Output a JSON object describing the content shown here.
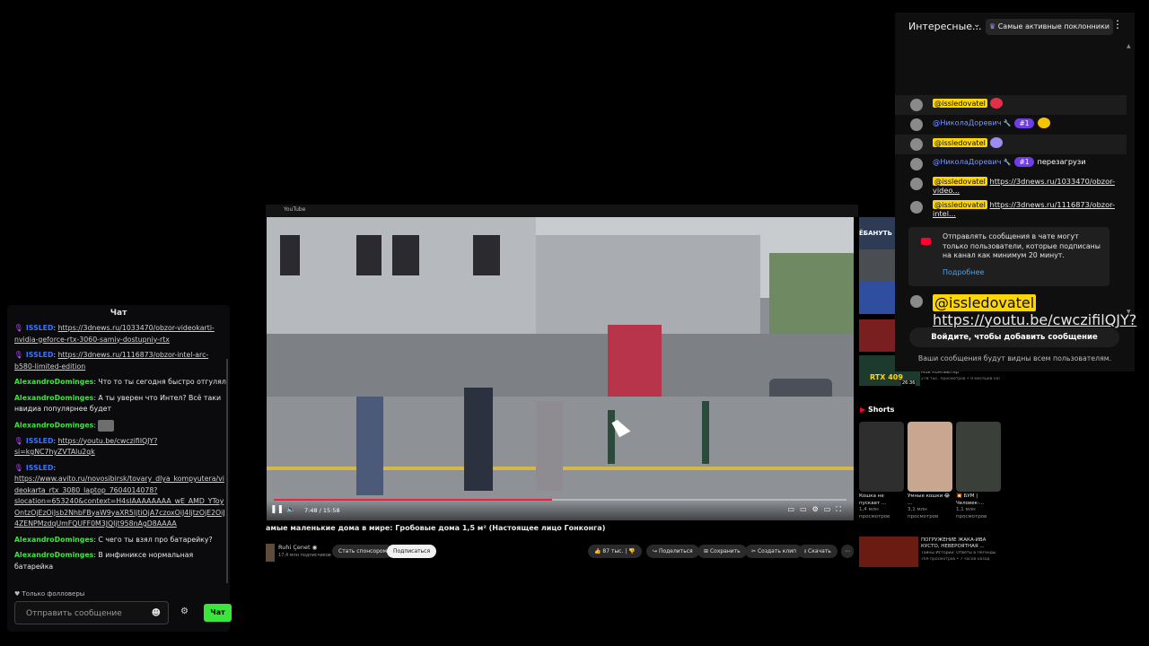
{
  "left_chat": {
    "title": "Чат",
    "messages": [
      {
        "icon": "🎙",
        "user": "ISSLED",
        "user_color": "#3a74ff",
        "text": "",
        "link": "https://3dnews.ru/1033470/obzor-videokarti-nvidia-geforce-rtx-3060-samiy-dostupniy-rtx"
      },
      {
        "icon": "🎙",
        "user": "ISSLED",
        "user_color": "#3a74ff",
        "text": "",
        "link": "https://3dnews.ru/1116873/obzor-intel-arc-b580-limited-edition"
      },
      {
        "icon": "",
        "user": "AlexandroDominges",
        "user_color": "#3be63b",
        "text": "Что то ты сегодня быстро отгулял",
        "link": ""
      },
      {
        "icon": "",
        "user": "AlexandroDominges",
        "user_color": "#3be63b",
        "text": "А ты уверен что Интел? Всё таки нвидиа популярнее будет",
        "link": ""
      },
      {
        "icon": "",
        "user": "AlexandroDominges",
        "user_color": "#3be63b",
        "text": "",
        "link": "",
        "emote": "cat-emote"
      },
      {
        "icon": "🎙",
        "user": "ISSLED",
        "user_color": "#3a74ff",
        "text": "",
        "link": "https://youtu.be/cwczifilQJY?si=kgNC7hyZVTAlu2qk"
      },
      {
        "icon": "🎙",
        "user": "ISSLED",
        "user_color": "#3a74ff",
        "text": "",
        "link": "https://www.avito.ru/novosibirsk/tovary_dlya_kompyutera/videokarta_rtx_3080_laptop_7604014078?slocation=653240&context=H4sIAAAAAAAA_wE_AMD_YToyOntzOjEzOiJsb2NhbFByaW9yaXR5IjtiOjA7czoxOiJ4IjtzOjE2OiJ4ZENPMzdqUmFQUFF0M3JQIjt958nAgD8AAAA"
      },
      {
        "icon": "",
        "user": "AlexandroDominges",
        "user_color": "#3be63b",
        "text": "С чего ты взял про батарейку?",
        "link": ""
      },
      {
        "icon": "",
        "user": "AlexandroDominges",
        "user_color": "#3be63b",
        "text": "В инфиниксе нормальная батарейка",
        "link": ""
      }
    ],
    "followers_only": "Только фолловеры",
    "input_placeholder": "Отправить сообщение",
    "send_label": "Чат"
  },
  "youtube": {
    "top_logo": "YouTube",
    "time": "7:48 / 15:58",
    "progress": 0.486,
    "title": "амые маленькие дома в мире: Гробовые дома 1,5 м² (Настоящее лицо Гонконга)",
    "channel": "Ruhi Çenet",
    "channel_subs": "17,4 млн подписчиков",
    "sponsor_label": "Стать спонсором",
    "subscribe_label": "Подписаться",
    "likes": "87 тыс.",
    "share_label": "Поделиться",
    "save_label": "Сохранить",
    "clip_label": "Создать клип",
    "download_label": "Скачать",
    "side_overlay_text": "ЁБАНУТЬ",
    "side_rtx_label": "RTX 409",
    "side_duration": "26:36",
    "side_channel": "Мой Компьютер",
    "side_channel_meta": "278 тыс. просмотров • 9 месяцев назад",
    "shorts_label": "Shorts",
    "shorts": [
      {
        "title": "Кошка не пускает ...",
        "views": "1,4 млн просмотров"
      },
      {
        "title": "Умные кошки 😂 ...",
        "views": "3,1 млн просмотров"
      },
      {
        "title": "💥 БУМ | Человек-...",
        "views": "1,1 млн просмотров"
      }
    ],
    "bottom_item_title": "ПОГРУЖЕНИЕ ЖАКА-ИВА КУСТО, НЕВЕРОЯТНАЯ ...",
    "bottom_item_channel": "Тайны Истории: Ответы в Легенды",
    "bottom_item_meta": "769 просмотров • 7 часов назад"
  },
  "yt_chat": {
    "title": "Интересные...",
    "chip_label": "Самые активные поклонники",
    "messages": [
      {
        "user": "@issledovatel",
        "owner": true,
        "rank": "",
        "text": "",
        "link": "",
        "emote_color": "#e0304a",
        "highlight": true
      },
      {
        "user": "@НиколаДоревич",
        "owner": false,
        "rank": "#1",
        "text": "",
        "link": "",
        "emote_color": "#f5c400",
        "highlight": false
      },
      {
        "user": "@issledovatel",
        "owner": true,
        "rank": "",
        "text": "",
        "link": "",
        "emote_color": "#9b8cf0",
        "highlight": true
      },
      {
        "user": "@НиколаДоревич",
        "owner": false,
        "rank": "#1",
        "text": "перезагрузи",
        "link": "",
        "emote_color": "",
        "highlight": false
      },
      {
        "user": "@issledovatel",
        "owner": true,
        "rank": "",
        "text": "",
        "link": "https://3dnews.ru/1033470/obzor-video...",
        "emote_color": "",
        "highlight": false
      },
      {
        "user": "@issledovatel",
        "owner": true,
        "rank": "",
        "text": "",
        "link": "https://3dnews.ru/1116873/obzor-intel...",
        "emote_color": "",
        "highlight": false
      }
    ],
    "notice_text": "Отправлять сообщения в чате могут только пользователи, которые подписаны на канал как минимум 20 минут.",
    "notice_more": "Подробнее",
    "last_message": {
      "user": "@issledovatel",
      "link": "https://youtu.be/cwczifilQJY?si=J MlhW..."
    },
    "signin_label": "Войдите, чтобы добавить сообщение",
    "visible_notice": "Ваши сообщения будут видны всем пользователям."
  }
}
